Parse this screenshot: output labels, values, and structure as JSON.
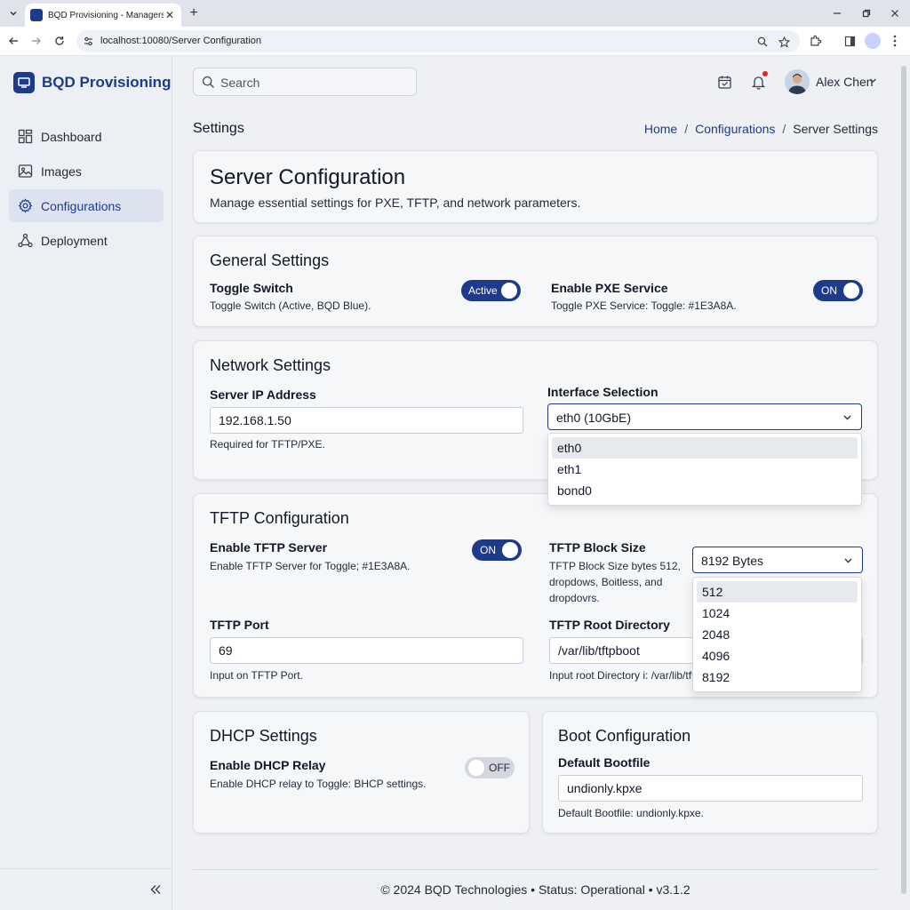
{
  "browser": {
    "tab_title": "BQD Provisioning - Managers & Settings",
    "url": "localhost:10080/Server Configuration"
  },
  "app": {
    "brand": "BQD Provisioning",
    "search_placeholder": "Search",
    "user_name": "Alex Chen"
  },
  "sidebar": {
    "items": [
      {
        "label": "Dashboard",
        "icon": "dashboard-icon"
      },
      {
        "label": "Images",
        "icon": "image-icon"
      },
      {
        "label": "Configurations",
        "icon": "gear-icon",
        "active": true
      },
      {
        "label": "Deployment",
        "icon": "deployment-icon"
      }
    ]
  },
  "page": {
    "title": "Settings",
    "breadcrumb": [
      "Home",
      "Configurations",
      "Server Settings"
    ],
    "separator": "/"
  },
  "hero": {
    "title": "Server Configuration",
    "subtitle": "Manage essential settings for PXE, TFTP, and network parameters."
  },
  "general": {
    "title": "General Settings",
    "toggle_switch_label": "Toggle Switch",
    "toggle_switch_help": "Toggle Switch (Active, BQD Blue).",
    "toggle_switch_state": "Active",
    "pxe_label": "Enable PXE Service",
    "pxe_help": "Toggle PXE Service: Toggle: #1E3A8A.",
    "pxe_state": "ON"
  },
  "network": {
    "title": "Network Settings",
    "ip_label": "Server IP Address",
    "ip_value": "192.168.1.50",
    "ip_help": "Required for TFTP/PXE.",
    "iface_label": "Interface Selection",
    "iface_value": "eth0 (10GbE)",
    "iface_options": [
      "eth0",
      "eth1",
      "bond0"
    ]
  },
  "tftp": {
    "title": "TFTP Configuration",
    "enable_label": "Enable TFTP Server",
    "enable_help": "Enable TFTP Server for Toggle; #1E3A8A.",
    "enable_state": "ON",
    "block_label": "TFTP Block Size",
    "block_help": "TFTP Block Size bytes 512, dropdows, Boitless, and dropdovrs.",
    "block_value": "8192 Bytes",
    "block_options": [
      "512",
      "1024",
      "2048",
      "4096",
      "8192"
    ],
    "port_label": "TFTP Port",
    "port_value": "69",
    "port_help": "Input on TFTP Port.",
    "root_label": "TFTP Root Directory",
    "root_value": "/var/lib/tftpboot",
    "root_help": "Input root Directory i: /var/lib/tftpboot."
  },
  "dhcp": {
    "title": "DHCP Settings",
    "relay_label": "Enable DHCP Relay",
    "relay_help": "Enable DHCP relay to Toggle: BHCP settings.",
    "relay_state": "OFF"
  },
  "boot": {
    "title": "Boot Configuration",
    "bootfile_label": "Default Bootfile",
    "bootfile_value": "undionly.kpxe",
    "bootfile_help": "Default Bootfile: undionly.kpxe."
  },
  "footer": {
    "text": "© 2024 BQD Technologies • Status: Operational • v3.1.2"
  },
  "colors": {
    "brand": "#1E3A8A",
    "toggle_off": "#D4D8DE",
    "notification": "#DC2626"
  }
}
